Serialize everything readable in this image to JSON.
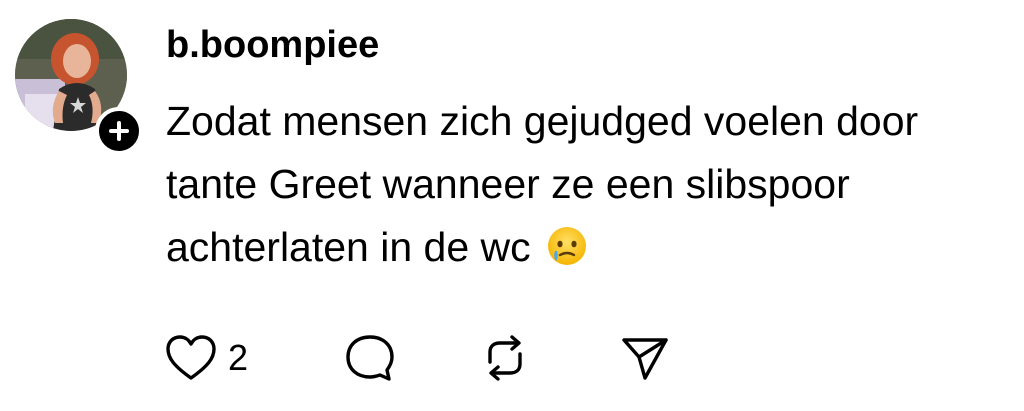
{
  "post": {
    "username": "b.boompiee",
    "text": "Zodat mensen zich gejudged voelen door tante Greet wanneer ze een slibspoor achterlaten in de wc",
    "emoji": "face-holding-back-tears-emoji",
    "avatar_alt": "profile-photo",
    "follow_icon": "plus-icon"
  },
  "actions": {
    "like_icon": "heart-icon",
    "like_count": "2",
    "reply_icon": "comment-bubble-icon",
    "repost_icon": "repost-icon",
    "share_icon": "send-icon"
  },
  "colors": {
    "text": "#000000",
    "background": "#ffffff",
    "badge": "#000000"
  }
}
